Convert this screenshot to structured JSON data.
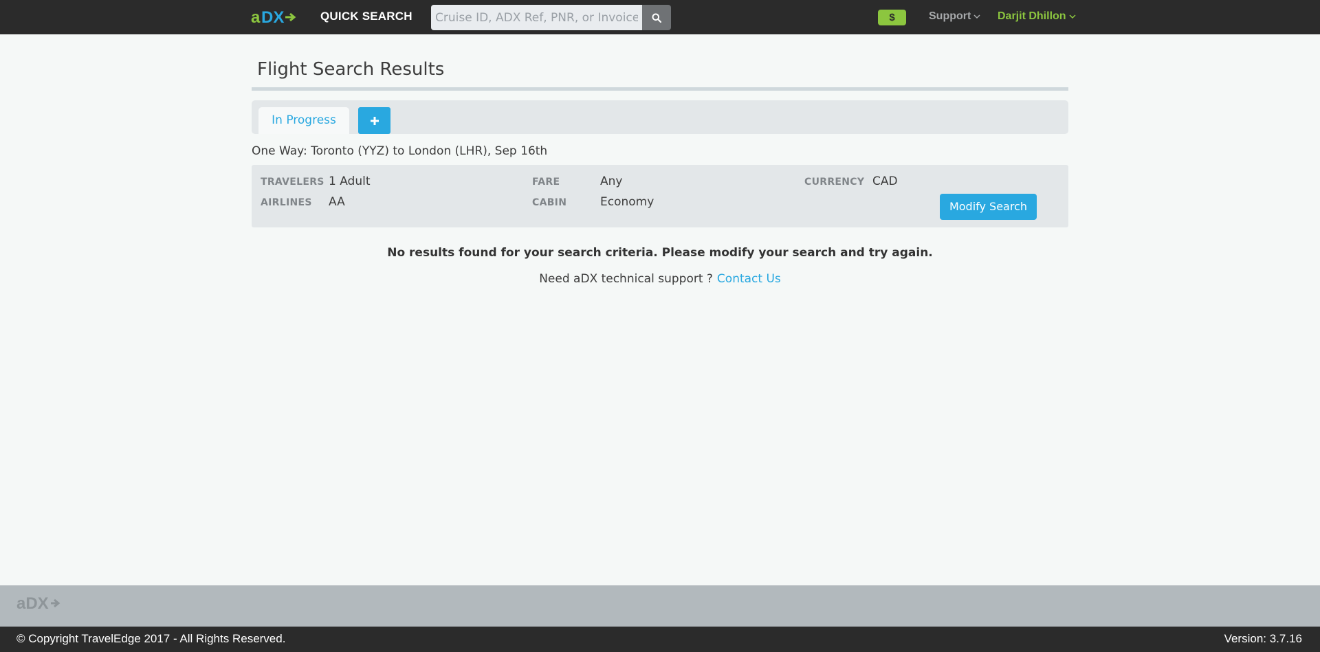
{
  "nav": {
    "logo": "aDX",
    "quick_search_label": "QUICK SEARCH",
    "search_placeholder": "Cruise ID, ADX Ref, PNR, or Invoice #...",
    "currency_badge": "$",
    "support_label": "Support",
    "user_name": "Darjit Dhillon"
  },
  "page": {
    "title": "Flight Search Results",
    "tabs": [
      {
        "label": "In Progress",
        "active": true
      }
    ],
    "route": "One Way: Toronto (YYZ) to London (LHR), Sep 16th"
  },
  "summary": {
    "travelers_label": "TRAVELERS",
    "travelers_value": "1 Adult",
    "airlines_label": "AIRLINES",
    "airlines_value": "AA",
    "fare_label": "FARE",
    "fare_value": "Any",
    "cabin_label": "CABIN",
    "cabin_value": "Economy",
    "currency_label": "CURRENCY",
    "currency_value": "CAD",
    "modify_button": "Modify Search"
  },
  "messages": {
    "no_results": "No results found for your search criteria. Please modify your search and try again.",
    "support_prompt": "Need aDX technical support ?",
    "contact_link": "Contact Us"
  },
  "footer": {
    "logo": "aDX",
    "copyright": "© Copyright TravelEdge 2017 - All Rights Reserved.",
    "version": "Version: 3.7.16"
  },
  "colors": {
    "accent": "#29a8e0",
    "brand_green": "#8cc63f",
    "nav_bg": "#2b2b2b"
  },
  "icons": {
    "search": "search-icon",
    "add_tab": "plus-icon",
    "dropdown": "chevron-down-icon"
  }
}
